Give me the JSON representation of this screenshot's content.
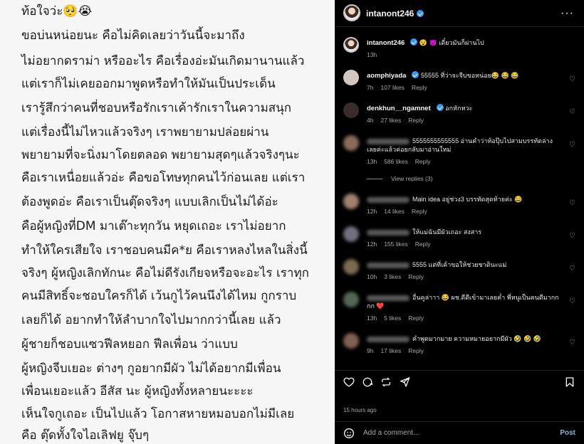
{
  "post_text": {
    "lines": [
      "ท้อใจว่ะ🥺😭",
      "ขอบ่นหน่อยนะ คือไม่คิดเลยว่าวันนี้จะมาถึง",
      "ไม่อยากดราม่า หรืออะไร คือเรื่องอ่ะมันเกิดมานานแล้ว",
      "แต่เราก็ไม่เคยออกมาพูดหรือทำให้มันเป็นประเด็น",
      "เรารู้สึกว่าคนที่ชอบหรือรักเราเค้ารักเราในความสนุก",
      "แต่เรื่องนี้ไม่ไหวแล้วจริงๆ เราพยายามปล่อยผ่าน",
      "พยายามที่จะนิ่งมาโดยตลอด พยายามสุดๆแล้วจริงๆนะ",
      "คือเราเหนื่อยแล้วอ่ะ คือขอโทษทุกคนไว้ก่อนเลย แต่เรา",
      "ต้องพูดอ่ะ คือเราเป็นตุ๊ดจริงๆ แบบเลิกเป็นไม่ได้อ่ะ",
      " คือผู้หญิงที่DM มาเต๊าะทุกวัน หยุดเถอะ เราไม่อยาก",
      "ทำให้ใครเสียใจ เราชอบคนมีค*ย คือเราหลงไหลในสิ่งนี้",
      "จริงๆ ผู้หญิงเลิกทักนะ คือไม่ดีรังเกียจหรือจะอะไร เราทุก",
      "คนมีสิทธิ์จะชอบใครก็ได้ เว้นกูไว้คนนึงได้ไหม กูกราบ",
      "เลยก็ได้ อยากทำให้ลำบากใจไปมากกว่านี้เลย แล้ว",
      "ผู้ชายก็ชอบแซวฟีลหยอก ฟีลเพื่อน ว่าแบบ",
      "ผู้หญิงจีบเยอะ ต่างๆ กูอยากมีผัว ไม่ได้อยากมีเพื่อน",
      "เพื่อนเยอะแล้ว อีสัส นะ ผู้หญิงทั้งหลายนะะะะ",
      "เห็นใจกูเถอะ เป็นไปแล้ว โอกาสหายหมอบอกไม่มีเลย",
      "คือ ตุ๊ดทั้งใจไอเลิฟยู จุ๊บๆ"
    ]
  },
  "panel": {
    "header_user": "intanont246",
    "more_icon": "more-horizontal-icon",
    "caption": {
      "user": "intanont246",
      "text": "😵 😈 เดี๋ยวมันก็ผ่านไป",
      "time": "13h"
    },
    "comments": [
      {
        "user": "aomphiyada",
        "text": "55555 ที่ว่าจะจีบขอหน่อย😂 😂 😂",
        "time": "7h",
        "likes": "107 likes",
        "reply": "Reply",
        "avatar": "#cfc7c0",
        "blurred": false
      },
      {
        "user": "denkhun__ngamnet",
        "text": "อกหักหวะ",
        "time": "4h",
        "likes": "27 likes",
        "reply": "Reply",
        "avatar": "#3b2b2b",
        "blurred": false
      },
      {
        "user": "",
        "text": "5555555555555 อ่านคำว่าท้อปุ๊บไปสามบรรทัดล่าง เลยค่ะแล้วค่อยกลับมาอ่านใหม่",
        "time": "13h",
        "likes": "586 likes",
        "reply": "Reply",
        "avatar": "#8a6b5a",
        "blurred": true
      },
      {
        "user": "",
        "text": "Main idea อยู่ช่วง3 บรรทัดสุดท้ายค่ะ 😂",
        "time": "12h",
        "likes": "14 likes",
        "reply": "Reply",
        "avatar": "#a08070",
        "blurred": true
      },
      {
        "user": "",
        "text": "ให้แม่ฉันมีผัวเถอะ สงสาร",
        "time": "12h",
        "likes": "155 likes",
        "reply": "Reply",
        "avatar": "#6f6f7f",
        "blurred": true
      },
      {
        "user": "",
        "text": "5555 แต่ที่เค้าขอให้ช่วยชาตินะแม่",
        "time": "10h",
        "likes": "3 likes",
        "reply": "Reply",
        "avatar": "#7a6a50",
        "blurred": true
      },
      {
        "user": "",
        "text": "อื่นคูล่าาา 😂 ผช.ดีดีเข้ามาเลยค่ำ พี่หนูเป็นคนดีมากกกก ❤️",
        "time": "13h",
        "likes": "5 likes",
        "reply": "Reply",
        "avatar": "#556655",
        "blurred": true
      },
      {
        "user": "",
        "text": "คำพูดมากมาย ความหมายอยากมีผัว 🤣 🤣 🤣",
        "time": "9h",
        "likes": "17 likes",
        "reply": "Reply",
        "avatar": "#806050",
        "blurred": true
      }
    ],
    "view_replies": "View replies (3)",
    "time_ago": "15 hours ago",
    "add_comment_placeholder": "Add a comment...",
    "post_label": "Post",
    "colors": {
      "bg": "#000000",
      "verified": "#3897f0",
      "post": "#8fb3d9"
    }
  }
}
